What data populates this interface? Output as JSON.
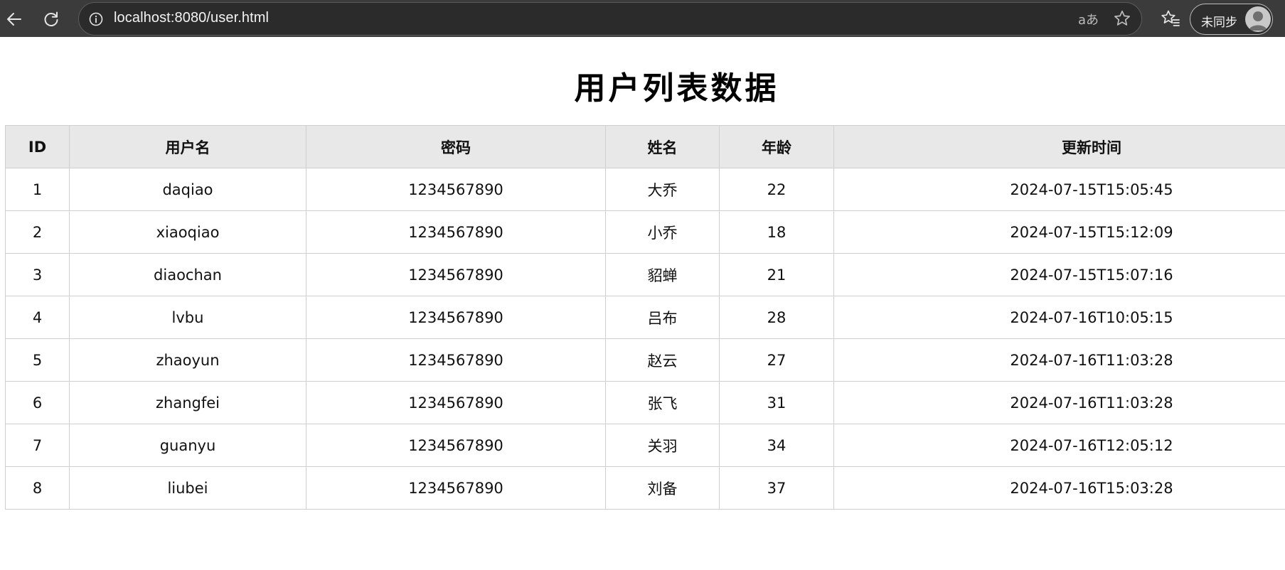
{
  "browser": {
    "url": "localhost:8080/user.html",
    "read_aloud_glyph": "aあ",
    "profile_label": "未同步",
    "icons": {
      "back": "back-arrow-icon",
      "reload": "reload-icon",
      "info": "info-icon",
      "star": "star-icon",
      "favorites": "favorites-icon",
      "avatar": "avatar-icon"
    }
  },
  "page": {
    "title": "用户列表数据"
  },
  "table": {
    "headers": [
      "ID",
      "用户名",
      "密码",
      "姓名",
      "年龄",
      "更新时间"
    ],
    "rows": [
      [
        "1",
        "daqiao",
        "1234567890",
        "大乔",
        "22",
        "2024-07-15T15:05:45"
      ],
      [
        "2",
        "xiaoqiao",
        "1234567890",
        "小乔",
        "18",
        "2024-07-15T15:12:09"
      ],
      [
        "3",
        "diaochan",
        "1234567890",
        "貂蝉",
        "21",
        "2024-07-15T15:07:16"
      ],
      [
        "4",
        "lvbu",
        "1234567890",
        "吕布",
        "28",
        "2024-07-16T10:05:15"
      ],
      [
        "5",
        "zhaoyun",
        "1234567890",
        "赵云",
        "27",
        "2024-07-16T11:03:28"
      ],
      [
        "6",
        "zhangfei",
        "1234567890",
        "张飞",
        "31",
        "2024-07-16T11:03:28"
      ],
      [
        "7",
        "guanyu",
        "1234567890",
        "关羽",
        "34",
        "2024-07-16T12:05:12"
      ],
      [
        "8",
        "liubei",
        "1234567890",
        "刘备",
        "37",
        "2024-07-16T15:03:28"
      ]
    ]
  }
}
